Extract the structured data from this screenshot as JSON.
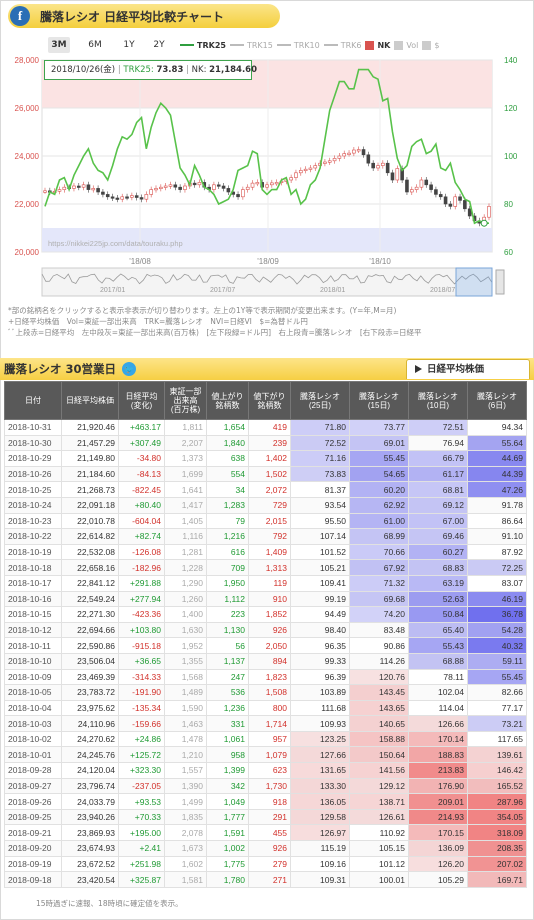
{
  "header": {
    "badge": "f",
    "title": "騰落レシオ 日経平均比較チャート"
  },
  "range_buttons": [
    "3M",
    "6M",
    "1Y",
    "2Y"
  ],
  "active_range": "3M",
  "legend": [
    {
      "label": "TRK25",
      "color": "#2f9e3f",
      "kind": "line"
    },
    {
      "label": "TRK15",
      "color": "#bbbbbb",
      "kind": "line"
    },
    {
      "label": "TRK10",
      "color": "#bbbbbb",
      "kind": "line"
    },
    {
      "label": "TRK6",
      "color": "#bbbbbb",
      "kind": "line"
    },
    {
      "label": "NK",
      "color": "#d9534f",
      "kind": "box"
    },
    {
      "label": "Vol",
      "color": "#cccccc",
      "kind": "box"
    },
    {
      "label": "$",
      "color": "#cccccc",
      "kind": "box"
    }
  ],
  "tooltip": {
    "date": "2018/10/26(金)",
    "trk_label": "TRK25:",
    "trk_value": "73.83",
    "nk_label": "NK:",
    "nk_value": "21,184.60"
  },
  "chart_data": {
    "type": "line",
    "left_axis": {
      "ticks": [
        "28,000",
        "26,000",
        "24,000",
        "22,000",
        "20,000"
      ],
      "ylim": [
        20000,
        28000
      ]
    },
    "right_axis": {
      "ticks": [
        "140",
        "120",
        "100",
        "80",
        "60"
      ],
      "ylim": [
        60,
        140
      ]
    },
    "x_ticks": [
      "'18/08",
      "'18/09",
      "'18/10"
    ],
    "nav_labels": [
      "2017/01",
      "2017/07",
      "2018/01",
      "2018/07"
    ],
    "watermark": "https://nikkei225jp.com/data/touraku.php",
    "bands": {
      "upper_ratio": 120,
      "lower_ratio": 70
    },
    "series": [
      {
        "name": "TRK25",
        "values": [
          79,
          85,
          84,
          90,
          91,
          86,
          92,
          96,
          100,
          103,
          97,
          94,
          93,
          90,
          96,
          103,
          108,
          107,
          109,
          114,
          116,
          103,
          112,
          118,
          122,
          120,
          117,
          106,
          95,
          92,
          88,
          96,
          92,
          87,
          86,
          84,
          80,
          81,
          82,
          86,
          94,
          95,
          96,
          102,
          101,
          86,
          84,
          86,
          86,
          90,
          91,
          84,
          86,
          80,
          82,
          88,
          90,
          95,
          107,
          119,
          125,
          131,
          131,
          128,
          128,
          136,
          136,
          136,
          133,
          132,
          123,
          124,
          110,
          99,
          94,
          96,
          104,
          106,
          107,
          101,
          102,
          105,
          95,
          94,
          97,
          89,
          86,
          82,
          81,
          72,
          73,
          72,
          72
        ]
      },
      {
        "name": "NK",
        "values": [
          22550,
          22500,
          22530,
          22600,
          22700,
          22650,
          22750,
          22700,
          22800,
          22600,
          22650,
          22500,
          22400,
          22300,
          22250,
          22200,
          22300,
          22280,
          22350,
          22270,
          22200,
          22400,
          22600,
          22650,
          22700,
          22750,
          22800,
          22700,
          22600,
          22750,
          22870,
          22800,
          22900,
          22700,
          22600,
          22800,
          22750,
          22650,
          22500,
          22400,
          22300,
          22600,
          22700,
          22870,
          22900,
          22700,
          22800,
          22880,
          22900,
          22950,
          23000,
          23100,
          23300,
          23400,
          23450,
          23500,
          23600,
          23700,
          23750,
          23800,
          23900,
          24000,
          24100,
          24120,
          24250,
          24270,
          24050,
          23700,
          23500,
          23600,
          23700,
          23300,
          23000,
          23480,
          23000,
          22500,
          22600,
          22700,
          23000,
          22800,
          22600,
          22400,
          22300,
          22000,
          21900,
          22300,
          22150,
          21800,
          21500,
          21300,
          21200,
          21450,
          21900
        ]
      }
    ]
  },
  "notes": [
    "*部の銘柄名をクリックすると表示非表示が切り替わります。左上の1Y等で表示期間が変更出来ます。(Y=年,M=月)",
    "+日経平均株価　Vol=東証一部出来高　TRK=騰落レシオ　NVI=日経VI　$=為替ドル円",
    "ﾞﾞ上段赤=日経平均　左中段灰=東証一部出来高(百万株)　[左下段緑=ドル円]　右上段青=騰落レシオ　[右下段赤=日経平"
  ],
  "table_title": "騰落レシオ 30営業日",
  "twitter_icon": "bird-icon",
  "tab_label": "日経平均株価",
  "columns": [
    "日付",
    "日経平均株価",
    "日経平均\n(変化)",
    "東証一部\n出来高\n(百万株)",
    "値上がり\n銘柄数",
    "値下がり\n銘柄数",
    "騰落レシオ\n(25日)",
    "騰落レシオ\n(15日)",
    "騰落レシオ\n(10日)",
    "騰落レシオ\n(6日)"
  ],
  "rows": [
    [
      "2018-10-31",
      "21,920.46",
      "+463.17",
      "1,811",
      "1,654",
      "419",
      "71.80",
      "73.77",
      "72.51",
      "94.34"
    ],
    [
      "2018-10-30",
      "21,457.29",
      "+307.49",
      "2,207",
      "1,840",
      "239",
      "72.52",
      "69.01",
      "76.94",
      "55.64"
    ],
    [
      "2018-10-29",
      "21,149.80",
      "-34.80",
      "1,373",
      "638",
      "1,402",
      "71.16",
      "55.45",
      "66.79",
      "44.69"
    ],
    [
      "2018-10-26",
      "21,184.60",
      "-84.13",
      "1,699",
      "554",
      "1,502",
      "73.83",
      "54.65",
      "61.17",
      "44.39"
    ],
    [
      "2018-10-25",
      "21,268.73",
      "-822.45",
      "1,641",
      "34",
      "2,072",
      "81.37",
      "60.20",
      "68.81",
      "47.26"
    ],
    [
      "2018-10-24",
      "22,091.18",
      "+80.40",
      "1,417",
      "1,283",
      "729",
      "93.54",
      "62.92",
      "69.12",
      "91.78"
    ],
    [
      "2018-10-23",
      "22,010.78",
      "-604.04",
      "1,405",
      "79",
      "2,015",
      "95.50",
      "61.00",
      "67.00",
      "86.64"
    ],
    [
      "2018-10-22",
      "22,614.82",
      "+82.74",
      "1,116",
      "1,216",
      "792",
      "107.14",
      "68.99",
      "69.46",
      "91.10"
    ],
    [
      "2018-10-19",
      "22,532.08",
      "-126.08",
      "1,281",
      "616",
      "1,409",
      "101.52",
      "70.66",
      "60.27",
      "87.92"
    ],
    [
      "2018-10-18",
      "22,658.16",
      "-182.96",
      "1,228",
      "709",
      "1,313",
      "105.21",
      "67.92",
      "68.83",
      "72.25"
    ],
    [
      "2018-10-17",
      "22,841.12",
      "+291.88",
      "1,290",
      "1,950",
      "119",
      "109.41",
      "71.32",
      "63.19",
      "83.07"
    ],
    [
      "2018-10-16",
      "22,549.24",
      "+277.94",
      "1,260",
      "1,112",
      "910",
      "99.19",
      "69.68",
      "52.63",
      "46.19"
    ],
    [
      "2018-10-15",
      "22,271.30",
      "-423.36",
      "1,400",
      "223",
      "1,852",
      "94.49",
      "74.20",
      "50.84",
      "36.78"
    ],
    [
      "2018-10-12",
      "22,694.66",
      "+103.80",
      "1,630",
      "1,130",
      "926",
      "98.40",
      "83.48",
      "65.40",
      "54.28"
    ],
    [
      "2018-10-11",
      "22,590.86",
      "-915.18",
      "1,952",
      "56",
      "2,050",
      "96.35",
      "90.86",
      "55.43",
      "40.32"
    ],
    [
      "2018-10-10",
      "23,506.04",
      "+36.65",
      "1,355",
      "1,137",
      "894",
      "99.33",
      "114.26",
      "68.88",
      "59.11"
    ],
    [
      "2018-10-09",
      "23,469.39",
      "-314.33",
      "1,568",
      "247",
      "1,823",
      "96.39",
      "120.76",
      "78.11",
      "55.45"
    ],
    [
      "2018-10-05",
      "23,783.72",
      "-191.90",
      "1,489",
      "536",
      "1,508",
      "103.89",
      "143.45",
      "102.04",
      "82.66"
    ],
    [
      "2018-10-04",
      "23,975.62",
      "-135.34",
      "1,590",
      "1,236",
      "800",
      "111.68",
      "143.65",
      "114.04",
      "77.17"
    ],
    [
      "2018-10-03",
      "24,110.96",
      "-159.66",
      "1,463",
      "331",
      "1,714",
      "109.93",
      "140.65",
      "126.66",
      "73.21"
    ],
    [
      "2018-10-02",
      "24,270.62",
      "+24.86",
      "1,478",
      "1,061",
      "957",
      "123.25",
      "158.88",
      "170.14",
      "117.65"
    ],
    [
      "2018-10-01",
      "24,245.76",
      "+125.72",
      "1,210",
      "958",
      "1,079",
      "127.66",
      "150.64",
      "188.83",
      "139.61"
    ],
    [
      "2018-09-28",
      "24,120.04",
      "+323.30",
      "1,557",
      "1,399",
      "623",
      "131.65",
      "141.56",
      "213.83",
      "146.42"
    ],
    [
      "2018-09-27",
      "23,796.74",
      "-237.05",
      "1,390",
      "342",
      "1,730",
      "133.30",
      "129.12",
      "176.90",
      "165.52"
    ],
    [
      "2018-09-26",
      "24,033.79",
      "+93.53",
      "1,499",
      "1,049",
      "918",
      "136.05",
      "138.71",
      "209.01",
      "287.96"
    ],
    [
      "2018-09-25",
      "23,940.26",
      "+70.33",
      "1,835",
      "1,777",
      "291",
      "129.58",
      "126.61",
      "214.93",
      "354.05"
    ],
    [
      "2018-09-21",
      "23,869.93",
      "+195.00",
      "2,078",
      "1,591",
      "455",
      "126.97",
      "110.92",
      "170.15",
      "318.09"
    ],
    [
      "2018-09-20",
      "23,674.93",
      "+2.41",
      "1,673",
      "1,002",
      "926",
      "115.19",
      "105.15",
      "136.09",
      "208.35"
    ],
    [
      "2018-09-19",
      "23,672.52",
      "+251.98",
      "1,602",
      "1,775",
      "279",
      "109.16",
      "101.12",
      "126.20",
      "207.02"
    ],
    [
      "2018-09-18",
      "23,420.54",
      "+325.87",
      "1,581",
      "1,780",
      "271",
      "109.31",
      "100.01",
      "105.29",
      "169.71"
    ]
  ],
  "footer": "15時過ぎに速報、18時頃に確定値を表示。"
}
